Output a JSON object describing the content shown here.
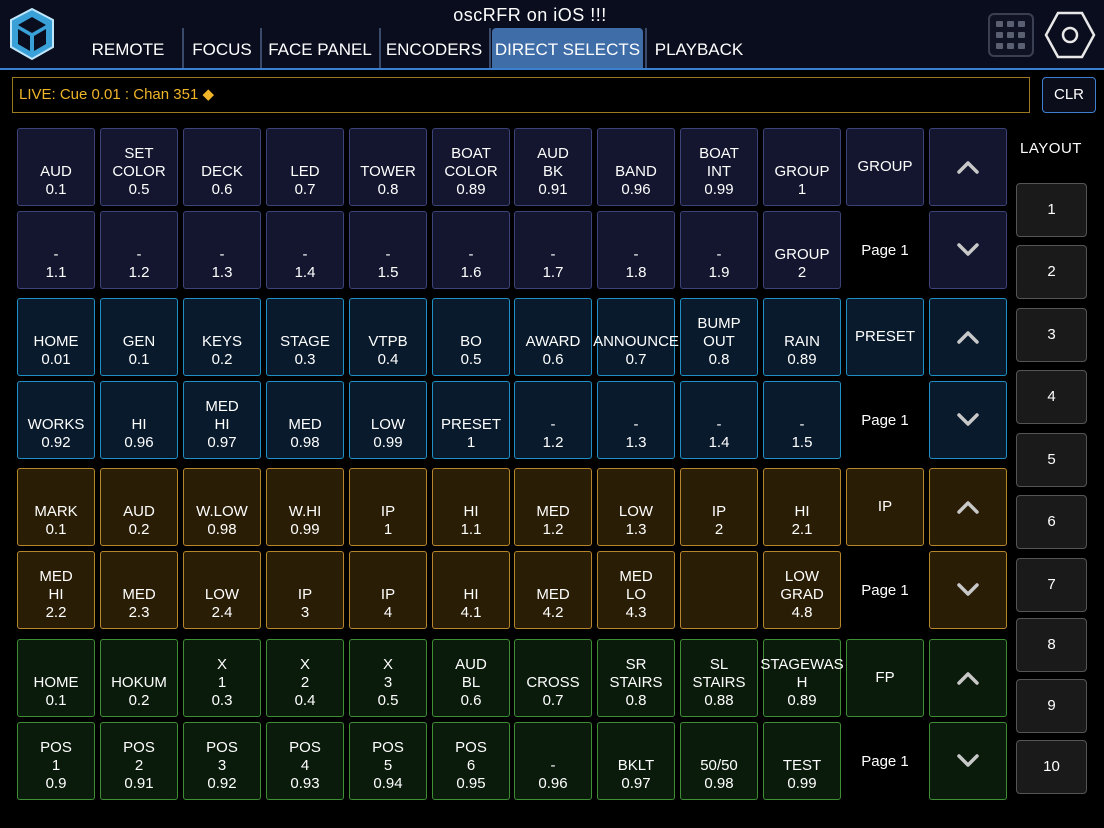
{
  "app": {
    "title": "oscRFR  on  iOS !!!"
  },
  "tabs": [
    {
      "label": "REMOTE"
    },
    {
      "label": "FOCUS"
    },
    {
      "label": "FACE PANEL"
    },
    {
      "label": "ENCODERS"
    },
    {
      "label": "DIRECT SELECTS",
      "active": true
    },
    {
      "label": "PLAYBACK"
    }
  ],
  "command_line": {
    "text": "LIVE: Cue  0.01 : Chan 351 ◆"
  },
  "clear_button": {
    "label": "CLR"
  },
  "colors": {
    "accent": "#3f6da8",
    "command_text": "#f0b429",
    "group_borders": [
      "#3c4378",
      "#1f8fc4",
      "#b8862a",
      "#3e8f34"
    ]
  },
  "groups": [
    {
      "title": "GROUP",
      "page": "Page 1",
      "rows": [
        [
          [
            "AUD",
            "0.1"
          ],
          [
            "SET",
            "COLOR",
            "0.5"
          ],
          [
            "DECK",
            "0.6"
          ],
          [
            "LED",
            "0.7"
          ],
          [
            "TOWER",
            "0.8"
          ],
          [
            "BOAT",
            "COLOR",
            "0.89"
          ],
          [
            "AUD",
            "BK",
            "0.91"
          ],
          [
            "BAND",
            "0.96"
          ],
          [
            "BOAT",
            "INT",
            "0.99"
          ],
          [
            "GROUP",
            "1"
          ]
        ],
        [
          [
            "-",
            "1.1"
          ],
          [
            "-",
            "1.2"
          ],
          [
            "-",
            "1.3"
          ],
          [
            "-",
            "1.4"
          ],
          [
            "-",
            "1.5"
          ],
          [
            "-",
            "1.6"
          ],
          [
            "-",
            "1.7"
          ],
          [
            "-",
            "1.8"
          ],
          [
            "-",
            "1.9"
          ],
          [
            "GROUP",
            "2"
          ]
        ]
      ]
    },
    {
      "title": "PRESET",
      "page": "Page 1",
      "rows": [
        [
          [
            "HOME",
            "0.01"
          ],
          [
            "GEN",
            "0.1"
          ],
          [
            "KEYS",
            "0.2"
          ],
          [
            "STAGE",
            "0.3"
          ],
          [
            "VTPB",
            "0.4"
          ],
          [
            "BO",
            "0.5"
          ],
          [
            "AWARD",
            "0.6"
          ],
          [
            "ANNOUNCE",
            "0.7"
          ],
          [
            "BUMP",
            "OUT",
            "0.8"
          ],
          [
            "RAIN",
            "0.89"
          ]
        ],
        [
          [
            "WORKS",
            "0.92"
          ],
          [
            "HI",
            "0.96"
          ],
          [
            "MED",
            "HI",
            "0.97"
          ],
          [
            "MED",
            "0.98"
          ],
          [
            "LOW",
            "0.99"
          ],
          [
            "PRESET",
            "1"
          ],
          [
            "-",
            "1.2"
          ],
          [
            "-",
            "1.3"
          ],
          [
            "-",
            "1.4"
          ],
          [
            "-",
            "1.5"
          ]
        ]
      ]
    },
    {
      "title": "IP",
      "page": "Page 1",
      "rows": [
        [
          [
            "MARK",
            "0.1"
          ],
          [
            "AUD",
            "0.2"
          ],
          [
            "W.LOW",
            "0.98"
          ],
          [
            "W.HI",
            "0.99"
          ],
          [
            "IP",
            "1"
          ],
          [
            "HI",
            "1.1"
          ],
          [
            "MED",
            "1.2"
          ],
          [
            "LOW",
            "1.3"
          ],
          [
            "IP",
            "2"
          ],
          [
            "HI",
            "2.1"
          ]
        ],
        [
          [
            "MED",
            "HI",
            "2.2"
          ],
          [
            "MED",
            "2.3"
          ],
          [
            "LOW",
            "2.4"
          ],
          [
            "IP",
            "3"
          ],
          [
            "IP",
            "4"
          ],
          [
            "HI",
            "4.1"
          ],
          [
            "MED",
            "4.2"
          ],
          [
            "MED",
            "LO",
            "4.3"
          ],
          [],
          [
            "LOW",
            "GRAD",
            "4.8"
          ]
        ]
      ]
    },
    {
      "title": "FP",
      "page": "Page 1",
      "rows": [
        [
          [
            "HOME",
            "0.1"
          ],
          [
            "HOKUM",
            "0.2"
          ],
          [
            "X",
            "1",
            "0.3"
          ],
          [
            "X",
            "2",
            "0.4"
          ],
          [
            "X",
            "3",
            "0.5"
          ],
          [
            "AUD",
            "BL",
            "0.6"
          ],
          [
            "CROSS",
            "0.7"
          ],
          [
            "SR",
            "STAIRS",
            "0.8"
          ],
          [
            "SL",
            "STAIRS",
            "0.88"
          ],
          [
            "STAGEWAS",
            "H",
            "0.89"
          ]
        ],
        [
          [
            "POS",
            "1",
            "0.9"
          ],
          [
            "POS",
            "2",
            "0.91"
          ],
          [
            "POS",
            "3",
            "0.92"
          ],
          [
            "POS",
            "4",
            "0.93"
          ],
          [
            "POS",
            "5",
            "0.94"
          ],
          [
            "POS",
            "6",
            "0.95"
          ],
          [
            "-",
            "0.96"
          ],
          [
            "BKLT",
            "0.97"
          ],
          [
            "50/50",
            "0.98"
          ],
          [
            "TEST",
            "0.99"
          ]
        ]
      ]
    }
  ],
  "layout": {
    "title": "LAYOUT",
    "buttons": [
      "1",
      "2",
      "3",
      "4",
      "5",
      "6",
      "7",
      "8",
      "9",
      "10"
    ]
  }
}
